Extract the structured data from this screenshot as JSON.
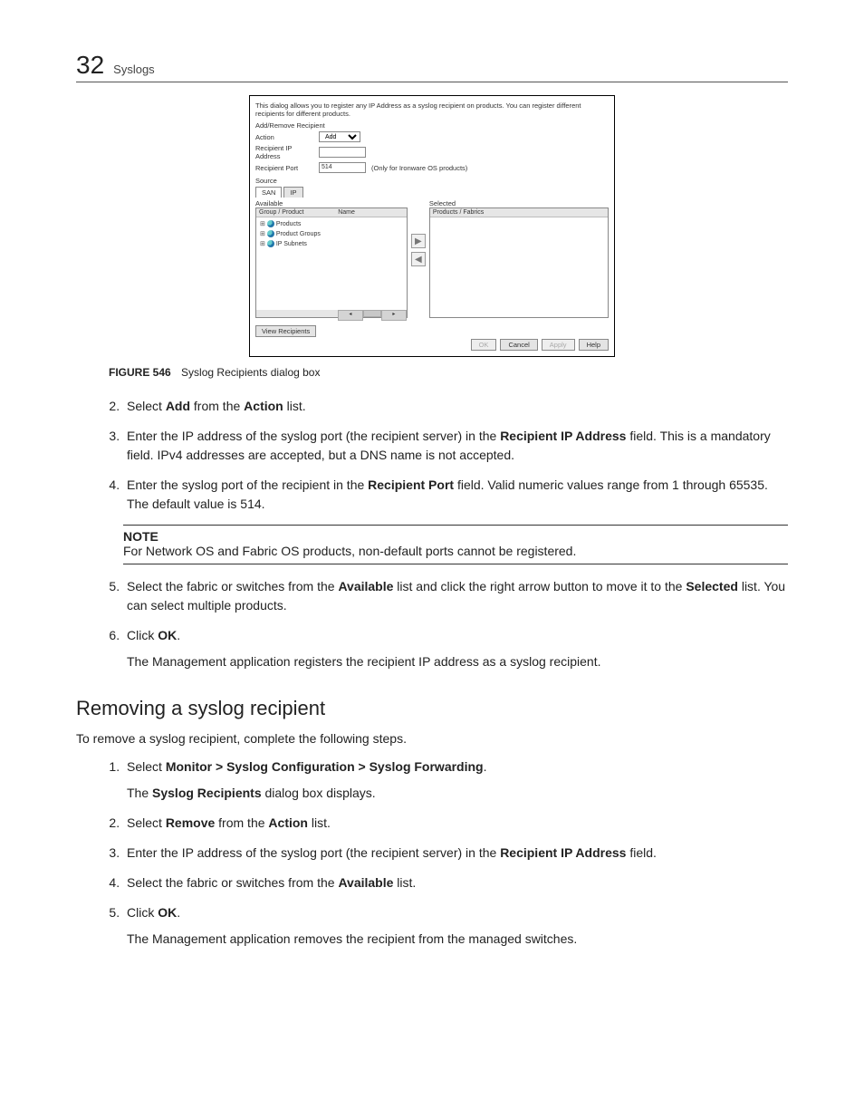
{
  "header": {
    "chapter_no": "32",
    "chapter_title": "Syslogs"
  },
  "dialog": {
    "description": "This dialog allows you to register any IP Address as a syslog recipient on products. You can register different recipients for different products.",
    "section_addremove": "Add/Remove Recipient",
    "labels": {
      "action": "Action",
      "recipient_ip": "Recipient IP Address",
      "recipient_port": "Recipient Port",
      "port_hint": "(Only for Ironware OS products)",
      "source": "Source"
    },
    "values": {
      "action": "Add",
      "recipient_port": "514"
    },
    "tabs": {
      "san": "SAN",
      "ip": "IP"
    },
    "left_pane": {
      "title": "Available",
      "col1": "Group / Product",
      "col2": "Name",
      "tree": [
        "Products",
        "Product Groups",
        "IP Subnets"
      ]
    },
    "right_pane": {
      "title": "Selected",
      "col1": "Products / Fabrics"
    },
    "view_recipients": "View Recipients",
    "buttons": {
      "ok": "OK",
      "cancel": "Cancel",
      "apply": "Apply",
      "help": "Help"
    }
  },
  "figure": {
    "label": "FIGURE 546",
    "caption": "Syslog Recipients dialog box"
  },
  "steps_a": {
    "2": {
      "pre": "Select ",
      "b1": "Add",
      "mid": " from the ",
      "b2": "Action",
      "post": " list."
    },
    "3": {
      "pre": "Enter the IP address of the syslog port (the recipient server) in the ",
      "b1": "Recipient IP Address",
      "post": " field. This is a mandatory field. IPv4 addresses are accepted, but a DNS name is not accepted."
    },
    "4": {
      "pre": "Enter the syslog port of the recipient in the ",
      "b1": "Recipient Port",
      "post": " field. Valid numeric values range from 1 through 65535. The default value is 514."
    }
  },
  "note": {
    "label": "NOTE",
    "text": "For Network OS and Fabric OS products, non-default ports cannot be registered."
  },
  "steps_b": {
    "5": {
      "pre": "Select the fabric or switches from the ",
      "b1": "Available",
      "mid": " list and click the right arrow button to move it to the ",
      "b2": "Selected",
      "post": " list. You can select multiple products."
    },
    "6": {
      "pre": "Click ",
      "b1": "OK",
      "post": ".",
      "sub": "The Management application registers the recipient IP address as a syslog recipient."
    }
  },
  "section2": {
    "heading": "Removing a syslog recipient",
    "intro": "To remove a syslog recipient, complete the following steps.",
    "steps": {
      "1": {
        "pre": "Select ",
        "b1": "Monitor > Syslog Configuration > Syslog Forwarding",
        "post": ".",
        "sub_pre": "The ",
        "sub_b": "Syslog Recipients",
        "sub_post": " dialog box displays."
      },
      "2": {
        "pre": "Select ",
        "b1": "Remove",
        "mid": " from the ",
        "b2": "Action",
        "post": " list."
      },
      "3": {
        "pre": "Enter the IP address of the syslog port (the recipient server) in the ",
        "b1": "Recipient IP Address",
        "post": " field."
      },
      "4": {
        "pre": "Select the fabric or switches from the ",
        "b1": "Available",
        "post": " list."
      },
      "5": {
        "pre": "Click ",
        "b1": "OK",
        "post": ".",
        "sub": "The Management application removes the recipient from the managed switches."
      }
    }
  }
}
